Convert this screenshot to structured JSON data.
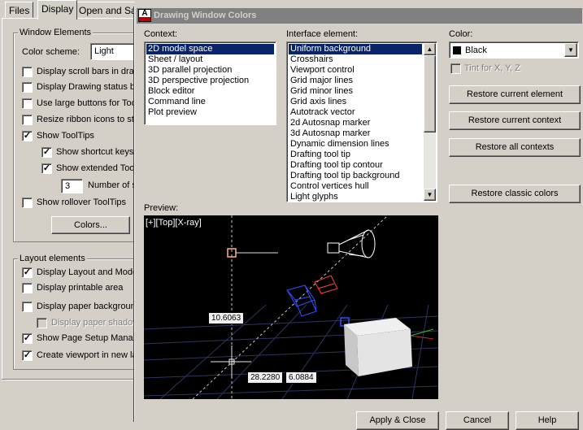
{
  "options_tabs": [
    "Files",
    "Display",
    "Open and Save"
  ],
  "window_elements": {
    "legend": "Window Elements",
    "color_scheme_label": "Color scheme:",
    "color_scheme_value": "Light",
    "options": [
      {
        "label": "Display scroll bars in drawing window",
        "checked": false
      },
      {
        "label": "Display Drawing status bar",
        "checked": false
      },
      {
        "label": "Use large buttons for Toolbars",
        "checked": false
      },
      {
        "label": "Resize ribbon icons to standard sizes",
        "checked": false
      },
      {
        "label": "Show ToolTips",
        "checked": true
      },
      {
        "label": "Show shortcut keys in ToolTips",
        "checked": true
      },
      {
        "label": "Show extended ToolTips",
        "checked": true
      }
    ],
    "delay_value": "3",
    "delay_label": "Number of seconds to delay",
    "rollover_label": "Show rollover ToolTips",
    "rollover_checked": false,
    "colors_button": "Colors..."
  },
  "layout_elements": {
    "legend": "Layout elements",
    "options": [
      {
        "label": "Display Layout and Model tabs",
        "checked": true
      },
      {
        "label": "Display printable area",
        "checked": false
      },
      {
        "label": "Display paper background",
        "checked": false
      },
      {
        "label": "Display paper shadow",
        "checked": false,
        "disabled": true
      },
      {
        "label": "Show Page Setup Manager for new layouts",
        "checked": true
      },
      {
        "label": "Create viewport in new layouts",
        "checked": true
      }
    ]
  },
  "dialog": {
    "title": "Drawing Window Colors",
    "app_icon_letter": "A",
    "context_label": "Context:",
    "contexts": [
      "2D model space",
      "Sheet / layout",
      "3D parallel projection",
      "3D perspective projection",
      "Block editor",
      "Command line",
      "Plot preview"
    ],
    "selected_context": 0,
    "interface_label": "Interface element:",
    "interface_elements": [
      "Uniform background",
      "Crosshairs",
      "Viewport control",
      "Grid major lines",
      "Grid minor lines",
      "Grid axis lines",
      "Autotrack vector",
      "2d Autosnap marker",
      "3d Autosnap marker",
      "Dynamic dimension lines",
      "Drafting tool tip",
      "Drafting tool tip contour",
      "Drafting tool tip background",
      "Control vertices hull",
      "Light glyphs"
    ],
    "selected_interface": 0,
    "color_label": "Color:",
    "color_value": "Black",
    "color_swatch": "#000000",
    "tint_label": "Tint for X, Y, Z",
    "restore_element": "Restore current element",
    "restore_context": "Restore current context",
    "restore_all": "Restore all contexts",
    "restore_classic": "Restore classic colors",
    "preview_label": "Preview:",
    "viewport_label": "[+][Top][X-ray]",
    "dim_1": "10.6063",
    "dim_2": "28.2280",
    "dim_3": "6.0884",
    "bottom_buttons": [
      "Apply & Close",
      "Cancel",
      "Help"
    ]
  },
  "colors": {
    "selection": "#0a246a",
    "titlebar": "#808080",
    "preview_bg": "#000000"
  }
}
